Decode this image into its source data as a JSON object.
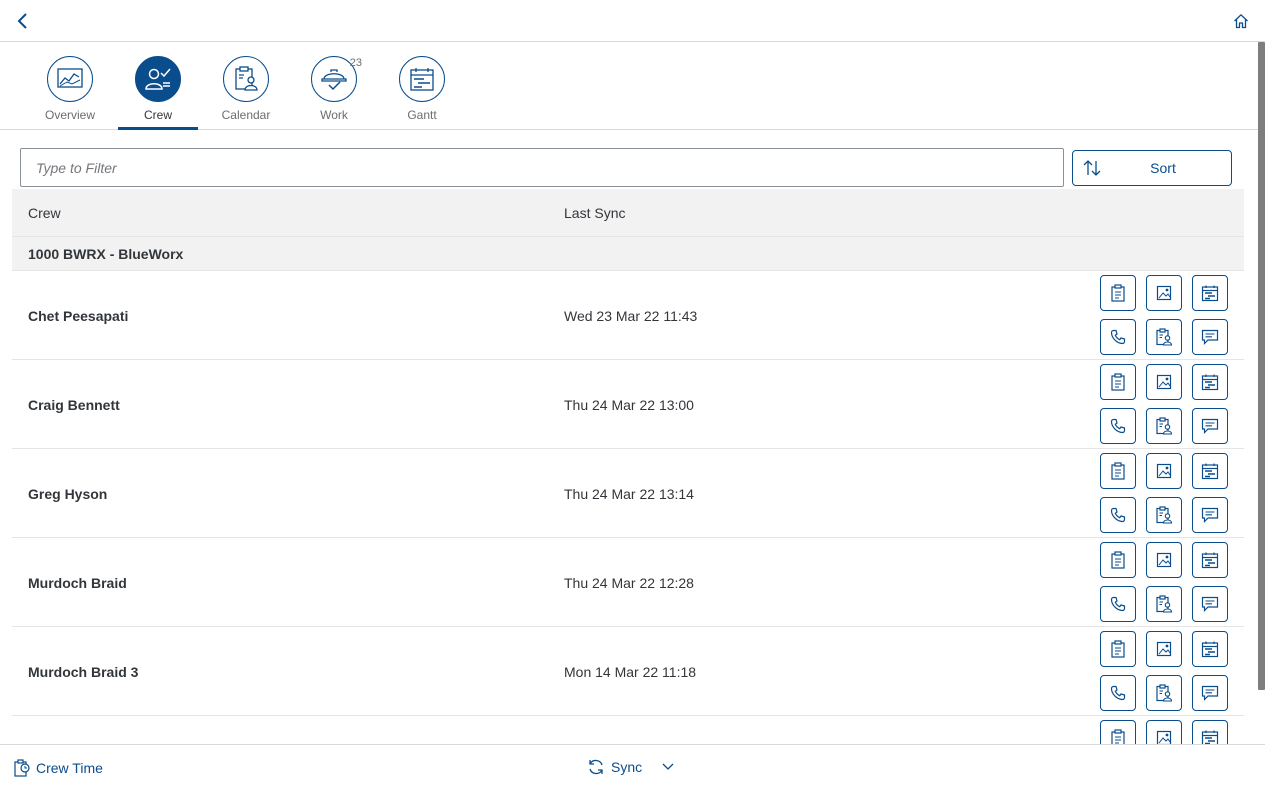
{
  "tabs": [
    {
      "label": "Overview",
      "icon": "chart-icon",
      "active": false
    },
    {
      "label": "Crew",
      "icon": "crew-icon",
      "active": true
    },
    {
      "label": "Calendar",
      "icon": "clipboard-person-icon",
      "active": false
    },
    {
      "label": "Work",
      "icon": "hardhat-icon",
      "active": false,
      "badge": "23"
    },
    {
      "label": "Gantt",
      "icon": "gantt-calendar-icon",
      "active": false
    }
  ],
  "filter": {
    "placeholder": "Type to Filter",
    "value": ""
  },
  "sort": {
    "label": "Sort"
  },
  "table": {
    "columns": [
      "Crew",
      "Last Sync"
    ],
    "group": "1000 BWRX - BlueWorx",
    "rows": [
      {
        "name": "Chet Peesapati",
        "last_sync": "Wed 23 Mar 22 11:43"
      },
      {
        "name": "Craig Bennett",
        "last_sync": "Thu 24 Mar 22 13:00"
      },
      {
        "name": "Greg Hyson",
        "last_sync": "Thu 24 Mar 22 13:14"
      },
      {
        "name": "Murdoch Braid",
        "last_sync": "Thu 24 Mar 22 12:28"
      },
      {
        "name": "Murdoch Braid 3",
        "last_sync": "Mon 14 Mar 22 11:18"
      },
      {
        "name": "",
        "last_sync": ""
      }
    ],
    "row_actions": [
      "clipboard-icon",
      "image-icon",
      "gantt-icon",
      "phone-icon",
      "clipboard-person-icon",
      "message-icon"
    ]
  },
  "footer": {
    "crew_time": "Crew Time",
    "sync": "Sync"
  },
  "colors": {
    "accent": "#0a4d8c",
    "header_bg": "#f2f2f2",
    "border": "#e5e5e5",
    "text": "#32363a"
  }
}
